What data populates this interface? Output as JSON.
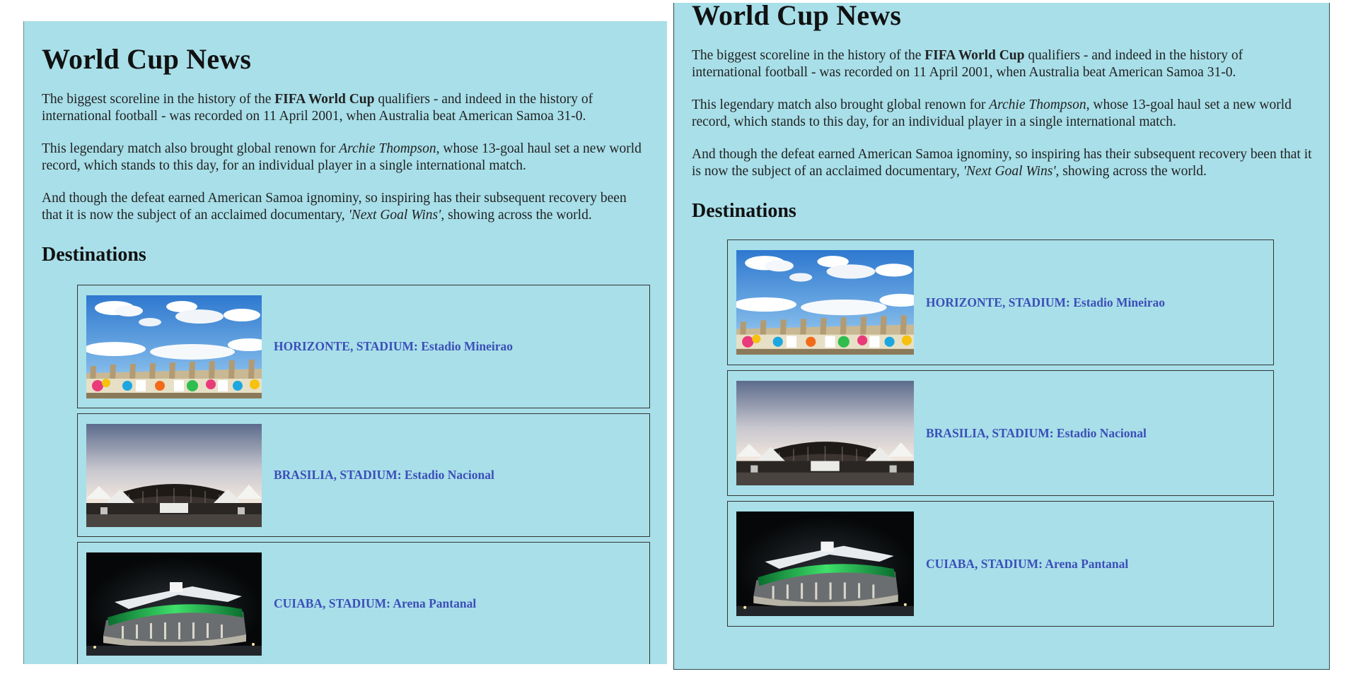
{
  "page": {
    "title": "World Cup News",
    "para1": {
      "pre": "The biggest scoreline in the history of the ",
      "bold": "FIFA World Cup",
      "post": " qualifiers - and indeed in the history of international football - was recorded on 11 April 2001, when Australia beat American Samoa 31-0."
    },
    "para2": {
      "pre": "This legendary match also brought global renown for ",
      "italic": "Archie Thompson",
      "post": ", whose 13-goal haul set a new world record, which stands to this day, for an individual player in a single international match."
    },
    "para3": {
      "pre": "And though the defeat earned American Samoa ignominy, so inspiring has their subsequent recovery been that it is now the subject of an acclaimed documentary, ",
      "italic": "'Next Goal Wins'",
      "post": ", showing across the world."
    },
    "destinations_heading": "Destinations",
    "destinations": [
      {
        "label": "HORIZONTE, STADIUM: Estadio Mineirao",
        "image": "stadium-mineirao-image"
      },
      {
        "label": "BRASILIA, STADIUM: Estadio Nacional",
        "image": "stadium-nacional-image"
      },
      {
        "label": "CUIABA, STADIUM: Arena Pantanal",
        "image": "arena-pantanal-image"
      }
    ]
  },
  "colors": {
    "background": "#a8dfe9",
    "link": "#3c4fb8",
    "text": "#222222"
  }
}
